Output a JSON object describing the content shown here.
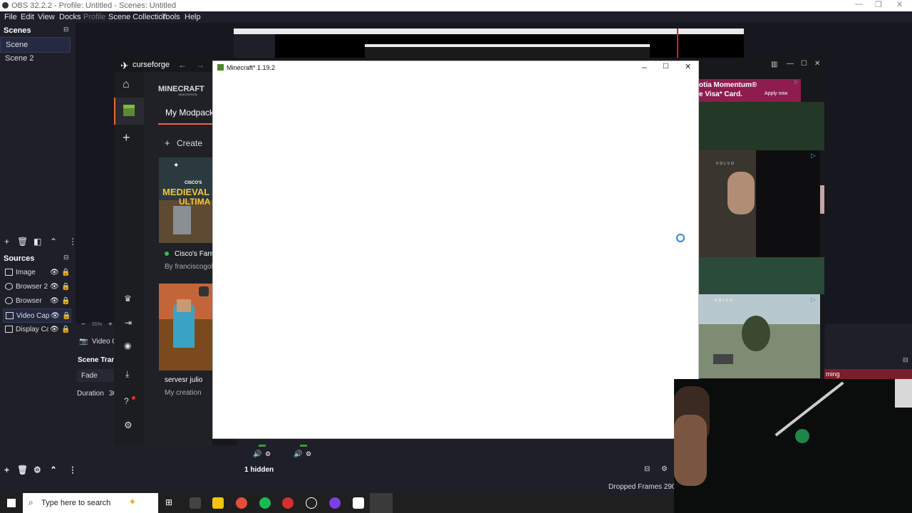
{
  "obs": {
    "title": "OBS 32.2.2 - Profile: Untitled - Scenes: Untitled",
    "menu": [
      "File",
      "Edit",
      "View",
      "Docks",
      "Profile",
      "Scene Collection",
      "Tools",
      "Help"
    ],
    "scenes_header": "Scenes",
    "scenes": [
      "Scene",
      "Scene 2"
    ],
    "sources_header": "Sources",
    "sources": [
      "Image",
      "Browser 2",
      "Browser",
      "Video Cap",
      "Display Ca"
    ],
    "zoom": "55%",
    "video_capture_label": "Video C",
    "scene_transitions_header": "Scene Trans",
    "transition": "Fade",
    "duration_label": "Duration",
    "duration_value": "30",
    "hidden_label": "1 hidden",
    "dropped_frames": "Dropped Frames 290 (0",
    "streaming_label": "ming"
  },
  "curseforge": {
    "brand": "curseforge",
    "game_logo": "MINECRAFT",
    "game_logo_sub": "JAVA EDITION",
    "tab_label": "My Modpack",
    "create_label": "Create",
    "cards": [
      {
        "title": "Cisco's Fanta",
        "author": "By franciscogold",
        "art_text": "MEDIEVAL",
        "art_sub": "ULTIMA",
        "art_top": "CISCO'S"
      },
      {
        "title": "servesr julio",
        "author": "My creation"
      }
    ]
  },
  "minecraft": {
    "title": "Minecraft* 1.19.2"
  },
  "ads": {
    "ad1_line1": "otia Momentum®",
    "ad1_line2": "e Visa* Card.",
    "ad1_button": "Apply now",
    "ad2_brand": "VOLVO",
    "ad3_brand": "VOLVO"
  },
  "taskbar": {
    "search_placeholder": "Type here to search"
  },
  "colors": {
    "obs_bg": "#1e1f29",
    "cf_accent": "#f16436",
    "selection": "#252941"
  }
}
